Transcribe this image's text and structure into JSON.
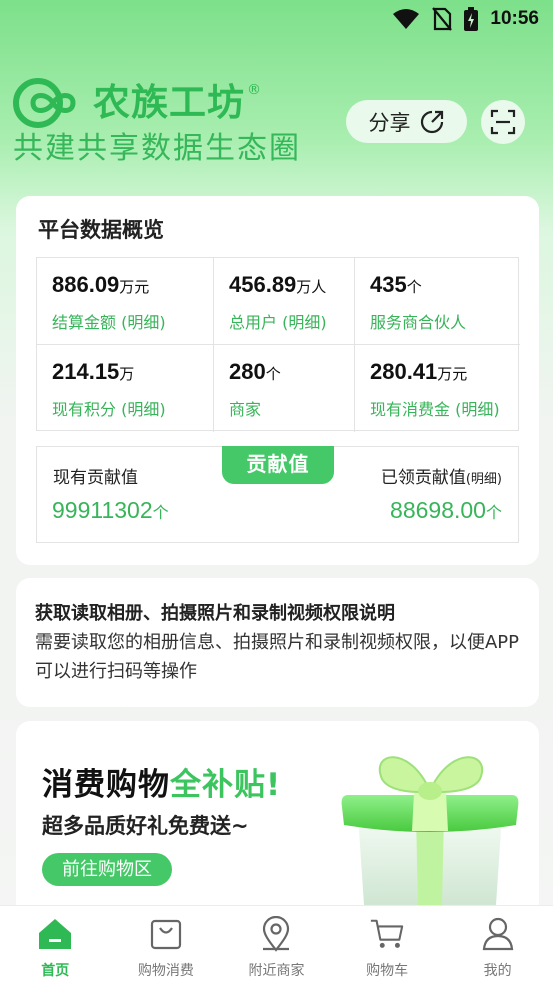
{
  "status_bar": {
    "time": "10:56",
    "icons": [
      "wifi-icon",
      "no-sim-icon",
      "battery-charging-icon"
    ]
  },
  "header": {
    "brand_name": "农族工坊",
    "brand_reg": "®",
    "slogan": "共建共享数据生态圈",
    "share_label": "分享",
    "brand_color": "#2fb955"
  },
  "overview": {
    "title": "平台数据概览",
    "stats": [
      {
        "value": "886.09",
        "unit": "万元",
        "label": "结算金额",
        "detail": " (明细)"
      },
      {
        "value": "456.89",
        "unit": "万人",
        "label": "总用户",
        "detail": " (明细)"
      },
      {
        "value": "435",
        "unit": "个",
        "label": "服务商合伙人",
        "detail": ""
      },
      {
        "value": "214.15",
        "unit": "万",
        "label": "现有积分",
        "detail": " (明细)"
      },
      {
        "value": "280",
        "unit": "个",
        "label": "商家",
        "detail": ""
      },
      {
        "value": "280.41",
        "unit": "万元",
        "label": "现有消费金",
        "detail": " (明细)"
      }
    ],
    "contribution": {
      "tag": "贡献值",
      "current_label": "现有贡献值",
      "current_value": "99911302",
      "current_unit": "个",
      "claimed_label": "已领贡献值",
      "claimed_detail": "(明细)",
      "claimed_value": "88698.00",
      "claimed_unit": "个"
    }
  },
  "permission": {
    "title": "获取读取相册、拍摄照片和录制视频权限说明",
    "body": "需要读取您的相册信息、拍摄照片和录制视频权限，以便APP可以进行扫码等操作"
  },
  "promo": {
    "title_main": "消费购物",
    "title_accent": "全补贴!",
    "subtitle": "超多品质好礼免费送~",
    "button": "前往购物区"
  },
  "nav": [
    {
      "label": "首页",
      "icon": "home-icon",
      "active": true
    },
    {
      "label": "购物消费",
      "icon": "shopping-bag-icon",
      "active": false
    },
    {
      "label": "附近商家",
      "icon": "location-pin-icon",
      "active": false
    },
    {
      "label": "购物车",
      "icon": "cart-icon",
      "active": false
    },
    {
      "label": "我的",
      "icon": "user-icon",
      "active": false
    }
  ],
  "colors": {
    "accent": "#45c867",
    "text_green": "#38b45a"
  }
}
